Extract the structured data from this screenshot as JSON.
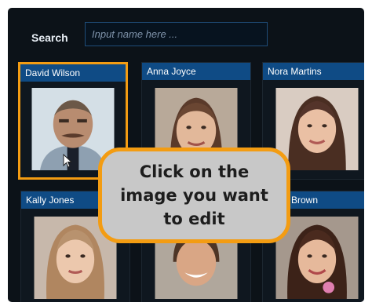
{
  "search": {
    "label": "Search",
    "placeholder": "Input name here ..."
  },
  "people": [
    {
      "name": "David Wilson"
    },
    {
      "name": "Anna Joyce"
    },
    {
      "name": "Nora Martins"
    },
    {
      "name": "Kally Jones"
    },
    {
      "name": ""
    },
    {
      "name": "Holly Brown"
    }
  ],
  "callout": {
    "text": "Click on the image you want to edit"
  },
  "colors": {
    "accent": "#f39c12",
    "name_bar": "#0f4b85",
    "panel": "#0c1218"
  }
}
